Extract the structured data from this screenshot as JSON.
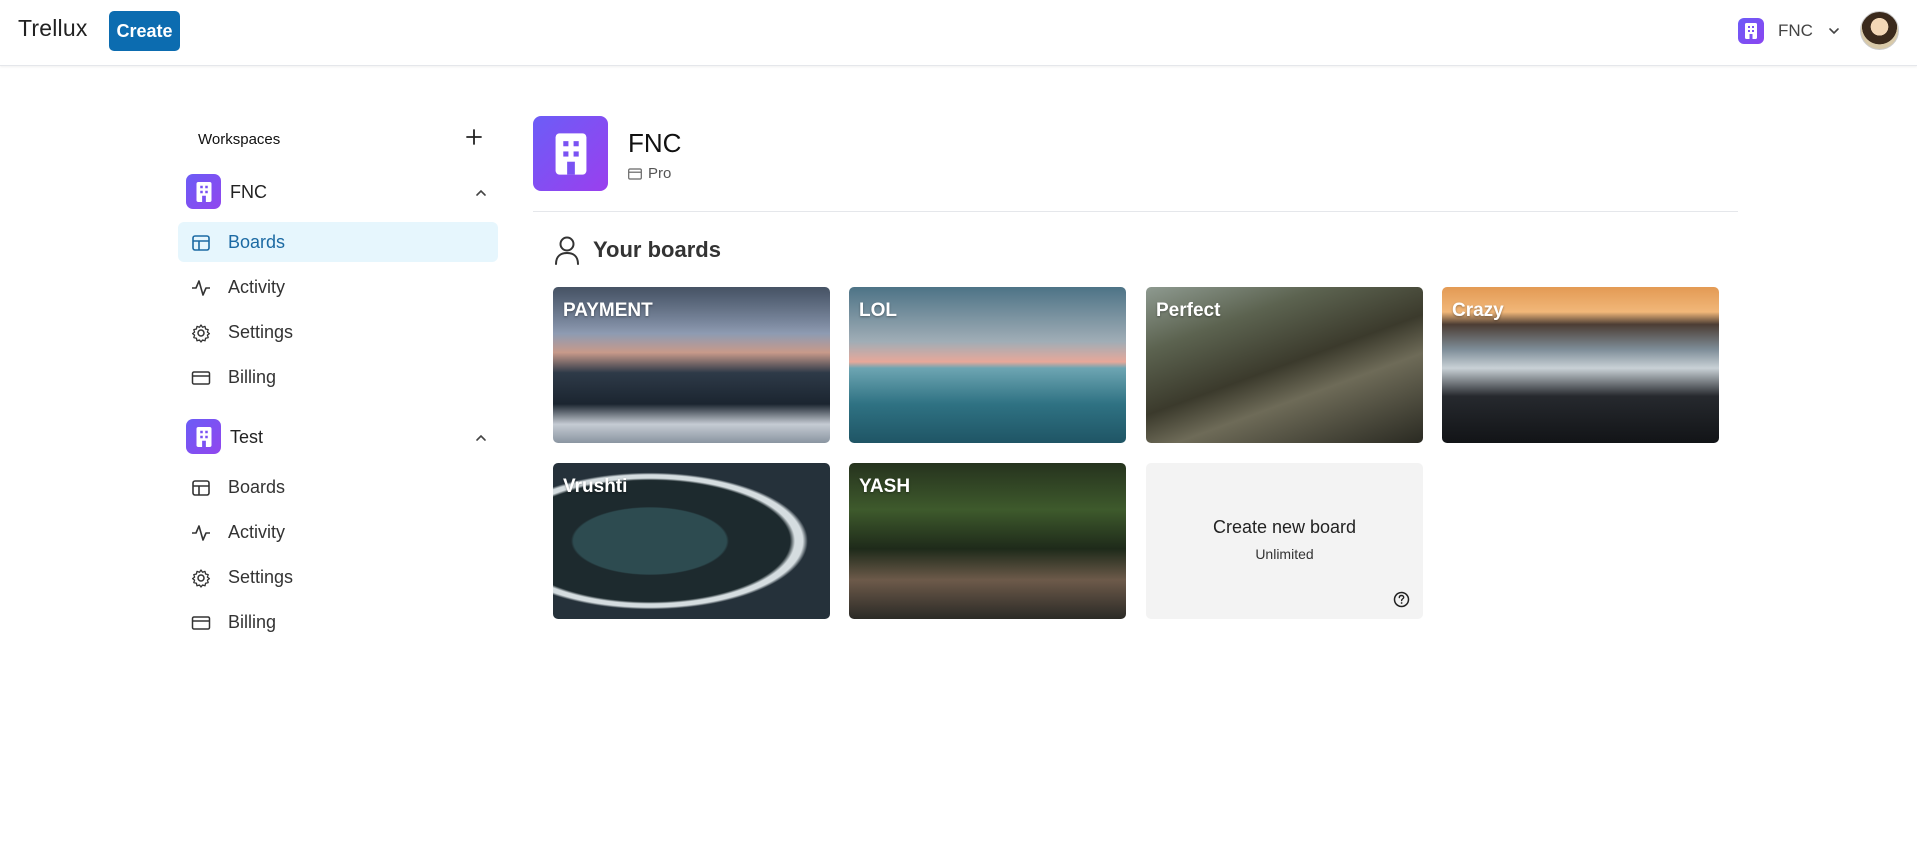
{
  "topbar": {
    "logo": "Trellux",
    "create_label": "Create",
    "workspace_switch_label": "FNC"
  },
  "sidebar": {
    "header_label": "Workspaces",
    "workspaces": [
      {
        "name": "FNC",
        "expanded": true,
        "items": [
          {
            "label": "Boards",
            "icon": "board-icon",
            "active": true
          },
          {
            "label": "Activity",
            "icon": "activity-icon",
            "active": false
          },
          {
            "label": "Settings",
            "icon": "gear-icon",
            "active": false
          },
          {
            "label": "Billing",
            "icon": "credit-card-icon",
            "active": false
          }
        ]
      },
      {
        "name": "Test",
        "expanded": true,
        "items": [
          {
            "label": "Boards",
            "icon": "board-icon",
            "active": false
          },
          {
            "label": "Activity",
            "icon": "activity-icon",
            "active": false
          },
          {
            "label": "Settings",
            "icon": "gear-icon",
            "active": false
          },
          {
            "label": "Billing",
            "icon": "credit-card-icon",
            "active": false
          }
        ]
      }
    ]
  },
  "main": {
    "workspace_title": "FNC",
    "plan_label": "Pro",
    "boards_heading": "Your boards",
    "boards": [
      {
        "title": "PAYMENT"
      },
      {
        "title": "LOL"
      },
      {
        "title": "Perfect"
      },
      {
        "title": "Crazy"
      },
      {
        "title": "Vrushti"
      },
      {
        "title": "YASH"
      }
    ],
    "create_board": {
      "title": "Create new board",
      "subtitle": "Unlimited"
    }
  },
  "colors": {
    "accent": "#0c6cb0",
    "workspace_icon": "#7a52f3",
    "active_nav_bg": "#e6f6fd",
    "active_nav_text": "#1c6aa3"
  }
}
